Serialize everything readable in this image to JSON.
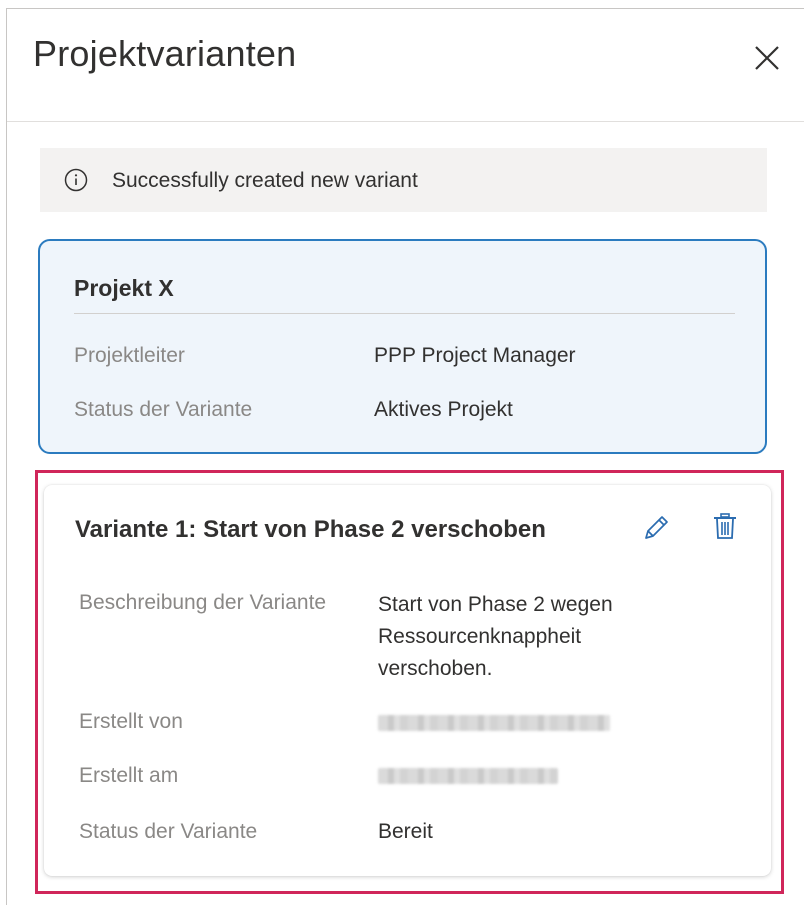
{
  "panel": {
    "title": "Projektvarianten",
    "close_icon": "close-icon"
  },
  "banner": {
    "icon": "info-icon",
    "message": "Successfully created new variant"
  },
  "project_card": {
    "name": "Projekt X",
    "accent_color": "#2b7bbf",
    "rows": [
      {
        "label": "Projektleiter",
        "value": "PPP Project Manager"
      },
      {
        "label": "Status der Variante",
        "value": "Aktives Projekt"
      }
    ]
  },
  "variant_card": {
    "name": "Variante 1: Start von Phase 2 verschoben",
    "highlight_color": "#d0265a",
    "edit_icon": "pencil-icon",
    "delete_icon": "trash-icon",
    "rows": {
      "description": {
        "label": "Beschreibung der Variante",
        "lines": [
          "Start von Phase 2 wegen",
          "Ressourcenknappheit",
          "verschoben."
        ]
      },
      "created_by": {
        "label": "Erstellt von",
        "value_redacted": true
      },
      "created_at": {
        "label": "Erstellt am",
        "value_redacted": true
      },
      "status": {
        "label": "Status der Variante",
        "value": "Bereit"
      }
    }
  }
}
